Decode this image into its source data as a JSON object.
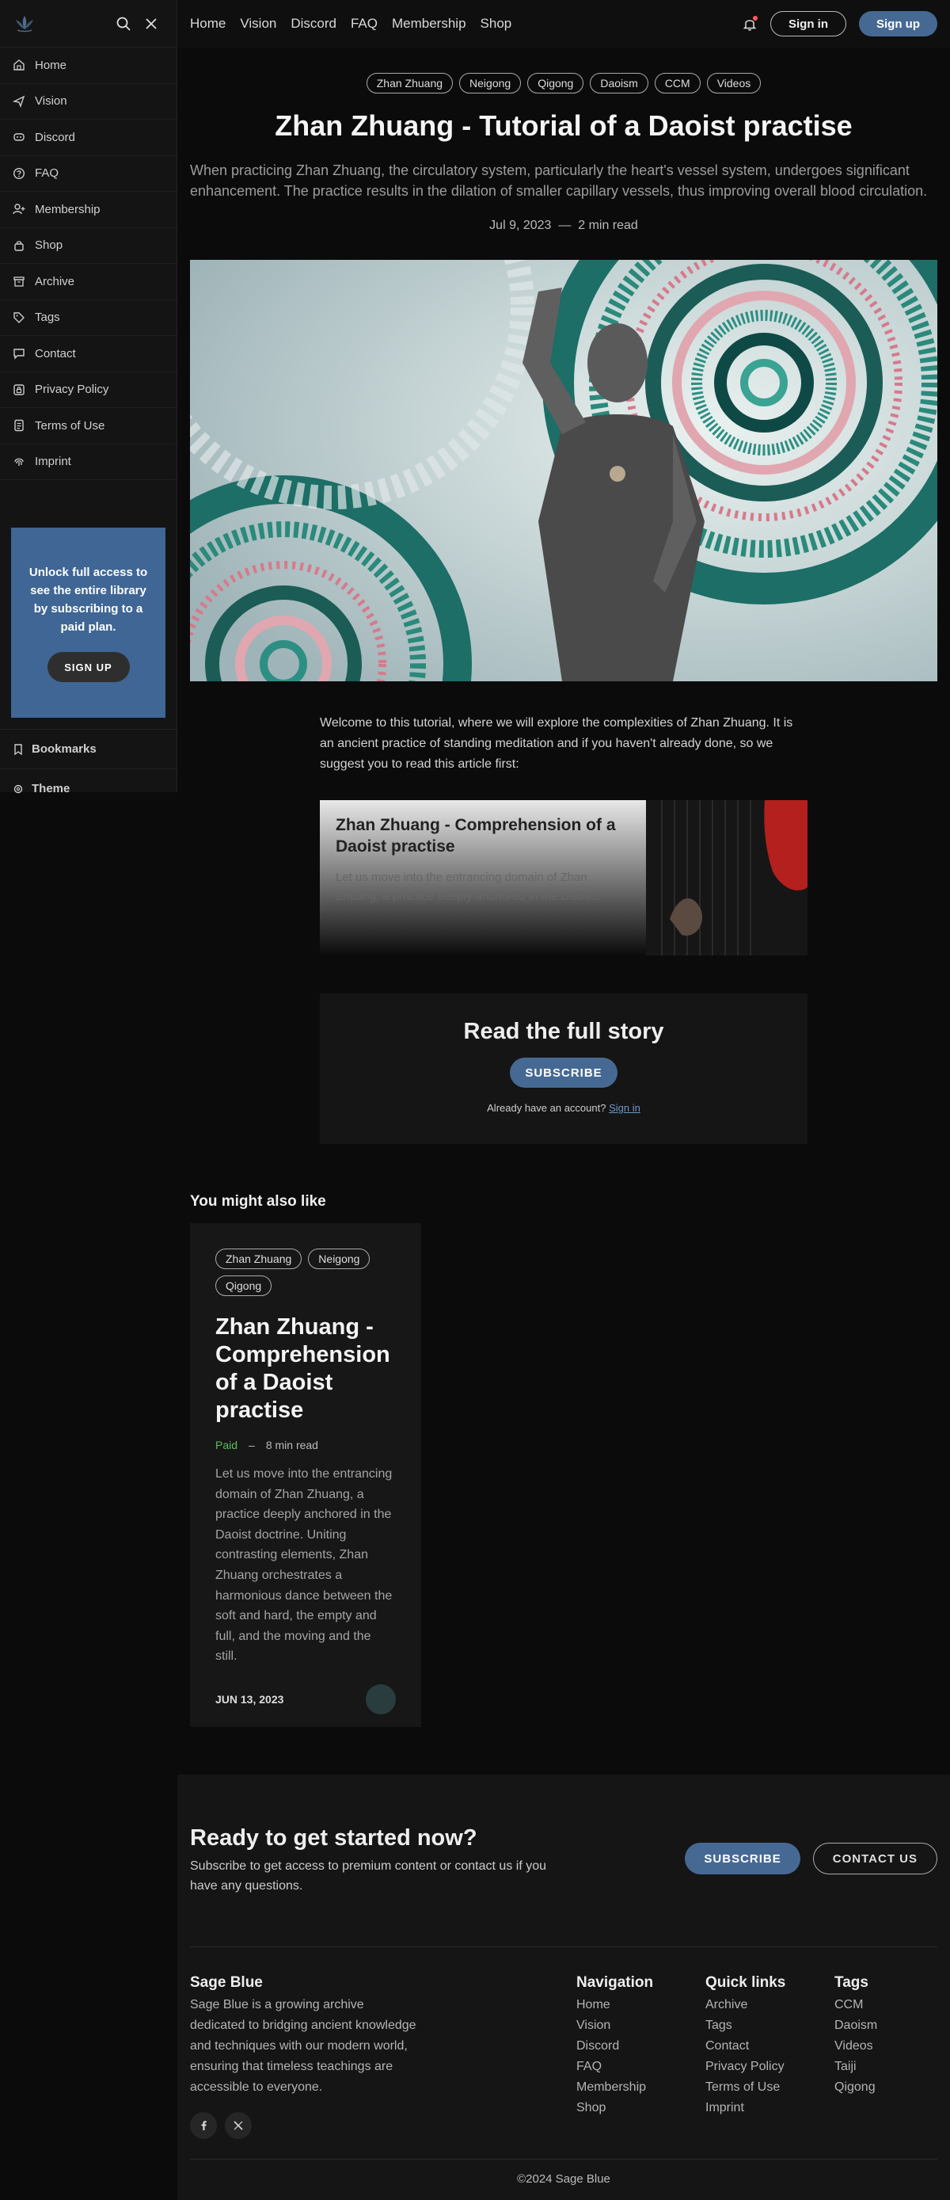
{
  "sidebar": {
    "items": [
      {
        "label": "Home",
        "icon": "home-icon"
      },
      {
        "label": "Vision",
        "icon": "paper-plane-icon"
      },
      {
        "label": "Discord",
        "icon": "discord-icon"
      },
      {
        "label": "FAQ",
        "icon": "question-icon"
      },
      {
        "label": "Membership",
        "icon": "user-plus-icon"
      },
      {
        "label": "Shop",
        "icon": "bag-icon"
      },
      {
        "label": "Archive",
        "icon": "archive-icon"
      },
      {
        "label": "Tags",
        "icon": "tag-icon"
      },
      {
        "label": "Contact",
        "icon": "chat-icon"
      },
      {
        "label": "Privacy Policy",
        "icon": "lock-box-icon"
      },
      {
        "label": "Terms of Use",
        "icon": "document-icon"
      },
      {
        "label": "Imprint",
        "icon": "fingerprint-icon"
      }
    ],
    "unlock_text": "Unlock full access to see the entire library by subscribing to a paid plan.",
    "signup_label": "SIGN UP",
    "bookmarks_label": "Bookmarks",
    "theme_label": "Theme"
  },
  "header": {
    "nav": [
      "Home",
      "Vision",
      "Discord",
      "FAQ",
      "Membership",
      "Shop"
    ],
    "signin_label": "Sign in",
    "signup_label": "Sign up"
  },
  "article": {
    "tags": [
      "Zhan Zhuang",
      "Neigong",
      "Qigong",
      "Daoism",
      "CCM",
      "Videos"
    ],
    "title": "Zhan Zhuang - Tutorial of a Daoist practise",
    "excerpt": "When practicing Zhan Zhuang, the circulatory system, particularly the heart's vessel system, undergoes significant enhancement. The practice results in the dilation of smaller capillary vessels, thus improving overall blood circulation.",
    "date": "Jul 9, 2023",
    "separator": "—",
    "read_time": "2 min read",
    "body": "Welcome to this tutorial, where we will explore the complexities of Zhan Zhuang. It is an ancient practice of standing meditation and if you haven't already done, so we suggest you to read this article first:",
    "bookmark": {
      "title": "Zhan Zhuang - Comprehension of a Daoist practise",
      "desc": "Let us move into the entrancing domain of Zhan Zhuang, a practice deeply anchored in the Daois..."
    },
    "cta": {
      "heading": "Read the full story",
      "button": "SUBSCRIBE",
      "account_text": "Already have an account?",
      "signin_link": "Sign in"
    }
  },
  "related": {
    "heading": "You might also like",
    "card": {
      "tags": [
        "Zhan Zhuang",
        "Neigong",
        "Qigong"
      ],
      "title": "Zhan Zhuang - Comprehension of a Daoist practise",
      "paid": "Paid",
      "dash": "–",
      "read_time": "8 min read",
      "desc": "Let us move into the entrancing domain of Zhan Zhuang, a practice deeply anchored in the Daoist doctrine. Uniting contrasting elements, Zhan Zhuang orchestrates a harmonious dance between the soft and hard, the empty and full, and the moving and the still.",
      "date": "JUN 13, 2023"
    }
  },
  "footer": {
    "cta_heading": "Ready to get started now?",
    "cta_text": "Subscribe to get access to premium content or contact us if you have any questions.",
    "subscribe_label": "SUBSCRIBE",
    "contact_label": "CONTACT US",
    "brand": "Sage Blue",
    "brand_desc": "Sage Blue is a growing archive dedicated to bridging ancient knowledge and techniques with our modern world, ensuring that timeless teachings are accessible to everyone.",
    "columns": [
      {
        "heading": "Navigation",
        "links": [
          "Home",
          "Vision",
          "Discord",
          "FAQ",
          "Membership",
          "Shop"
        ]
      },
      {
        "heading": "Quick links",
        "links": [
          "Archive",
          "Tags",
          "Contact",
          "Privacy Policy",
          "Terms of Use",
          "Imprint"
        ]
      },
      {
        "heading": "Tags",
        "links": [
          "CCM",
          "Daoism",
          "Videos",
          "Taiji",
          "Qigong"
        ]
      }
    ],
    "copyright": "©2024 Sage Blue"
  },
  "colors": {
    "accent": "#466994",
    "paid": "#5bbf5b",
    "background": "#0b0b0b"
  }
}
